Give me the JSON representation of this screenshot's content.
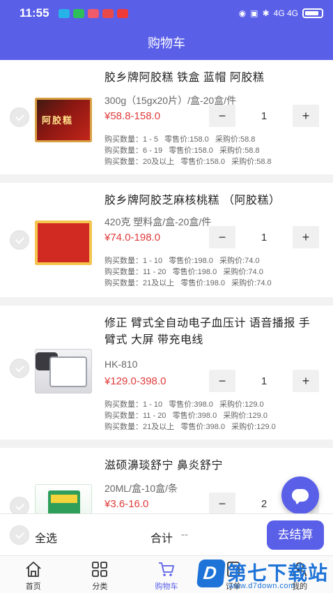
{
  "status_bar": {
    "time": "11:55",
    "network": "4G 4G"
  },
  "header": {
    "title": "购物车"
  },
  "items": [
    {
      "name": "胶乡牌阿胶糕 铁盒 蓝帽 阿胶糕",
      "spec": "300g（15gx20片）/盒-20盒/件",
      "price": "¥58.8-158.0",
      "qty": "1",
      "tiers": "购买数量：1 - 5   零售价:158.0   采购价:58.8\n购买数量：6 - 19   零售价:158.0   采购价:58.8\n购买数量：20及以上   零售价:158.0   采购价:58.8",
      "image_label": "阿胶糕"
    },
    {
      "name": "胶乡牌阿胶芝麻核桃糕 （阿胶糕）",
      "spec": "420克 塑料盒/盒-20盒/件",
      "price": "¥74.0-198.0",
      "qty": "1",
      "tiers": "购买数量：1 - 10   零售价:198.0   采购价:74.0\n购买数量：11 - 20   零售价:198.0   采购价:74.0\n购买数量：21及以上   零售价:198.0   采购价:74.0"
    },
    {
      "name": "修正 臂式全自动电子血压计 语音播报 手臂式 大屏 带充电线",
      "spec": "HK-810",
      "price": "¥129.0-398.0",
      "qty": "1",
      "tiers": "购买数量：1 - 10   零售价:398.0   采购价:129.0\n购买数量：11 - 20   零售价:398.0   采购价:129.0\n购买数量：21及以上   零售价:398.0   采购价:129.0"
    },
    {
      "name": "滋硕濞琰舒宁   鼻炎舒宁",
      "spec": "20ML/盒-10盒/条",
      "price": "¥3.6-16.0",
      "qty": "2"
    }
  ],
  "stepper": {
    "minus": "−",
    "plus": "+"
  },
  "checkout": {
    "select_all": "全选",
    "total_label": "合计",
    "total_value": "--",
    "submit": "去结算"
  },
  "tabs": [
    {
      "label": "首页",
      "icon": "home-icon"
    },
    {
      "label": "分类",
      "icon": "category-icon"
    },
    {
      "label": "购物车",
      "icon": "cart-icon"
    },
    {
      "label": "订单",
      "icon": "order-icon"
    },
    {
      "label": "我的",
      "icon": "profile-icon"
    }
  ],
  "colors": {
    "primary": "#5a5fe8",
    "price": "#e03b3b"
  },
  "watermark": {
    "badge": "D",
    "title": "第七下载站",
    "url": "www.d7down.com"
  }
}
